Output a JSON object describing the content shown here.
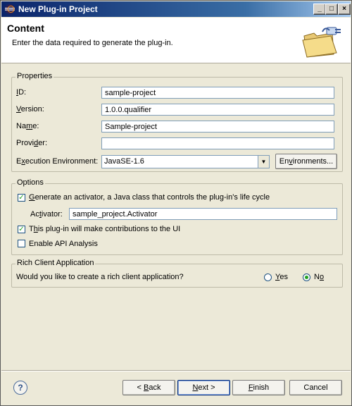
{
  "window": {
    "title": "New Plug-in Project",
    "controls": {
      "minimize": "_",
      "maximize": "□",
      "close": "×"
    }
  },
  "banner": {
    "title": "Content",
    "description": "Enter the data required to generate the plug-in."
  },
  "properties": {
    "legend": "Properties",
    "id": {
      "label_pre": "",
      "label_u": "I",
      "label_post": "D:",
      "value": "sample-project"
    },
    "version": {
      "label_pre": "",
      "label_u": "V",
      "label_post": "ersion:",
      "value": "1.0.0.qualifier"
    },
    "name": {
      "label_pre": "Na",
      "label_u": "m",
      "label_post": "e:",
      "value": "Sample-project"
    },
    "provider": {
      "label_pre": "Provi",
      "label_u": "d",
      "label_post": "er:",
      "value": ""
    },
    "environment": {
      "label_pre": "E",
      "label_u": "x",
      "label_post": "ecution Environment:",
      "value": "JavaSE-1.6",
      "button_pre": "En",
      "button_u": "v",
      "button_post": "ironments..."
    }
  },
  "options": {
    "legend": "Options",
    "generate_activator": {
      "checked": true,
      "label_pre": "",
      "label_u": "G",
      "label_post": "enerate an activator, a Java class that controls the plug-in's life cycle"
    },
    "activator": {
      "label_pre": "Ac",
      "label_u": "t",
      "label_post": "ivator:",
      "value": "sample_project.Activator"
    },
    "contributions": {
      "checked": true,
      "label_pre": "T",
      "label_u": "h",
      "label_post": "is plug-in will make contributions to the UI"
    },
    "api_analysis": {
      "checked": false,
      "label": "Enable API Analysis"
    }
  },
  "rcp": {
    "legend": "Rich Client Application",
    "question": "Would you like to create a rich client application?",
    "yes": {
      "label_pre": "",
      "label_u": "Y",
      "label_post": "es",
      "selected": false
    },
    "no": {
      "label_pre": "N",
      "label_u": "o",
      "label_post": "",
      "selected": true
    }
  },
  "footer": {
    "help_glyph": "?",
    "back": {
      "pre": "< ",
      "u": "B",
      "post": "ack"
    },
    "next": {
      "pre": "",
      "u": "N",
      "post": "ext >"
    },
    "finish": {
      "pre": "",
      "u": "F",
      "post": "inish"
    },
    "cancel": "Cancel"
  },
  "colors": {
    "title_bar_start": "#0a246a",
    "title_bar_end": "#a6caf0",
    "dialog_bg": "#ece9d8",
    "check_mark": "#21a121"
  },
  "icons": {
    "title": "eclipse-icon",
    "banner": "plugin-folder-icon",
    "help": "help-icon"
  }
}
